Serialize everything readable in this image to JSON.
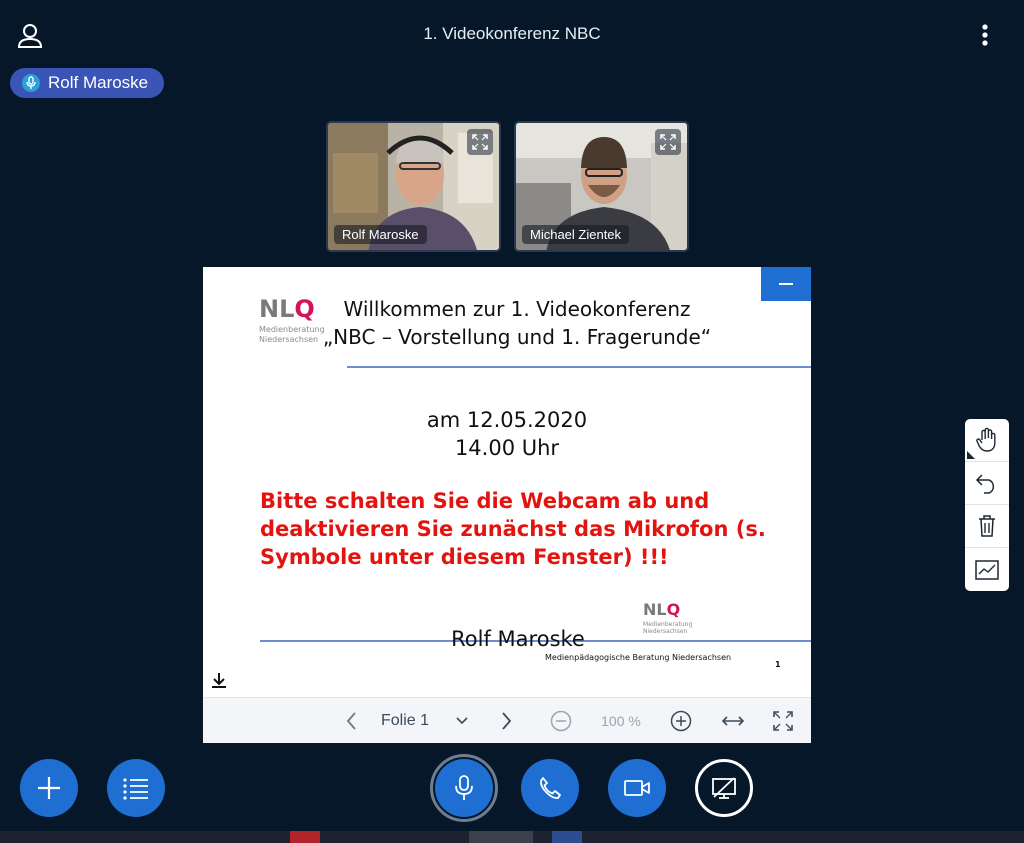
{
  "header": {
    "title": "1. Videokonferenz NBC",
    "user_icon": "user-icon",
    "menu_icon": "more-vertical-icon"
  },
  "speaker": {
    "name": "Rolf Maroske",
    "icon": "microphone-icon"
  },
  "videos": [
    {
      "name": "Rolf Maroske",
      "icon": "expand-icon"
    },
    {
      "name": "Michael Zientek",
      "icon": "expand-icon"
    }
  ],
  "slide": {
    "logo_letters_gray": "NL",
    "logo_letter_accent": "Q",
    "logo_sub_1": "Medienberatung",
    "logo_sub_2": "Niedersachsen",
    "title_line1": "Willkommen zur 1. Videokonferenz",
    "title_line2": "„NBC – Vorstellung und 1. Fragerunde“",
    "date_line1": "am 12.05.2020",
    "date_line2": "14.00 Uhr",
    "warning": "Bitte schalten Sie die Webcam ab und deaktivieren Sie zunächst das Mikrofon (s. Symbole unter diesem Fenster) !!!",
    "author": "Rolf Maroske",
    "organisation": "Medienpädagogische Beratung Niedersachsen",
    "page_number": "1"
  },
  "presentation_toolbar": {
    "slide_label": "Folie 1",
    "zoom": "100 %"
  },
  "colors": {
    "background": "#06172a",
    "accent": "#1f6fd2",
    "badge": "#3b55b6",
    "warning_red": "#e3140f",
    "nlq_magenta": "#d4145a"
  }
}
